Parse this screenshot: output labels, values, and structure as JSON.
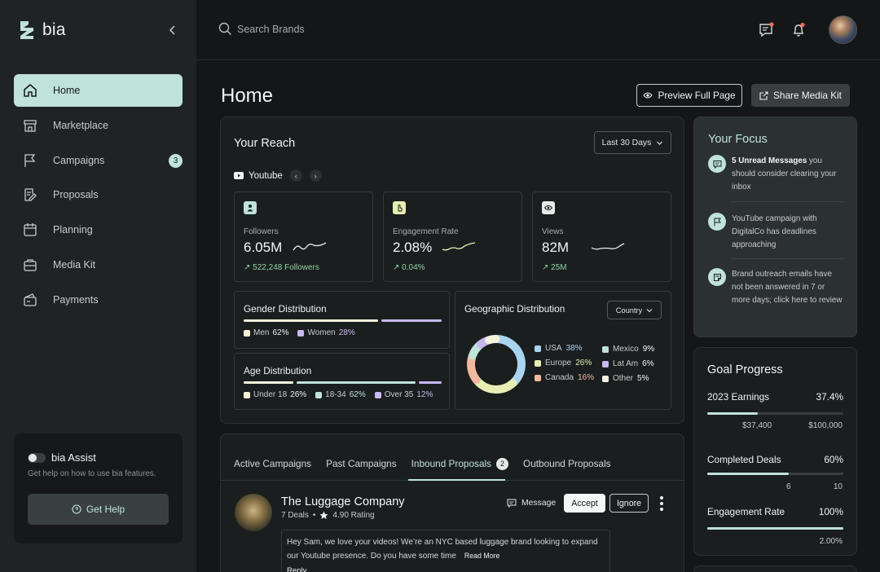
{
  "app": {
    "name": "bia"
  },
  "sidebar": {
    "items": [
      {
        "label": "Home",
        "icon": "home-icon",
        "active": true
      },
      {
        "label": "Marketplace",
        "icon": "store-icon"
      },
      {
        "label": "Campaigns",
        "icon": "flag-icon",
        "badge": "3"
      },
      {
        "label": "Proposals",
        "icon": "document-edit-icon"
      },
      {
        "label": "Planning",
        "icon": "calendar-icon"
      },
      {
        "label": "Media Kit",
        "icon": "briefcase-icon"
      },
      {
        "label": "Payments",
        "icon": "wallet-icon"
      }
    ],
    "assist": {
      "title": "bia Assist",
      "subtitle": "Get help on how to use bia features.",
      "button": "Get Help"
    }
  },
  "topbar": {
    "search_placeholder": "Search Brands"
  },
  "header": {
    "title": "Home",
    "preview_button": "Preview Full Page",
    "share_button": "Share Media Kit"
  },
  "reach": {
    "title": "Your Reach",
    "range": "Last 30 Days",
    "platform": "Youtube",
    "metrics": [
      {
        "label": "Followers",
        "value": "6.05M",
        "delta": "522,248 Followers",
        "icon_color": "#bfe3d8"
      },
      {
        "label": "Engagement Rate",
        "value": "2.08%",
        "delta": "0.04%",
        "icon_color": "#e6eeb3"
      },
      {
        "label": "Views",
        "value": "82M",
        "delta": "25M",
        "icon_color": "#e8eaea"
      }
    ],
    "gender": {
      "title": "Gender Distribution",
      "items": [
        {
          "label": "Men",
          "value": "62%",
          "pct": 0.62,
          "color": "#f5f3dc"
        },
        {
          "label": "Women",
          "value": "28%",
          "pct": 0.28,
          "color": "#c7b8f0"
        }
      ]
    },
    "age": {
      "title": "Age Distribution",
      "items": [
        {
          "label": "Under 18",
          "value": "26%",
          "pct": 0.26,
          "color": "#f5f3dc"
        },
        {
          "label": "18-34",
          "value": "62%",
          "pct": 0.62,
          "color": "#bfe3d8"
        },
        {
          "label": "Over 35",
          "value": "12%",
          "pct": 0.12,
          "color": "#c7b8f0"
        }
      ]
    },
    "geo": {
      "title": "Geographic Distribution",
      "filter": "Country",
      "items": [
        {
          "label": "USA",
          "value": "38%",
          "pct": 38,
          "color": "#a9d4ef"
        },
        {
          "label": "Europe",
          "value": "26%",
          "pct": 26,
          "color": "#e6eeb3"
        },
        {
          "label": "Canada",
          "value": "16%",
          "pct": 16,
          "color": "#f2b8a0"
        },
        {
          "label": "Mexico",
          "value": "9%",
          "pct": 9,
          "color": "#bfe3d8"
        },
        {
          "label": "Lat Am",
          "value": "6%",
          "pct": 6,
          "color": "#c7b8f0"
        },
        {
          "label": "Other",
          "value": "5%",
          "pct": 5,
          "color": "#f5f3dc"
        }
      ]
    }
  },
  "focus": {
    "title": "Your Focus",
    "items": [
      {
        "bold": "5 Unread Messages",
        "text": " you should consider clearing your inbox",
        "icon": "message-icon"
      },
      {
        "bold": "",
        "text": "YouTube campaign with DigitalCo has deadlines approaching",
        "icon": "flag-icon"
      },
      {
        "bold": "",
        "text": "Brand outreach emails have not been answered in 7 or more days; click here to review",
        "icon": "note-icon"
      }
    ]
  },
  "goals": {
    "title": "Goal Progress",
    "items": [
      {
        "label": "2023 Earnings",
        "value": "37.4%",
        "pct": 0.374,
        "current": "$37,400",
        "target": "$100,000"
      },
      {
        "label": "Completed Deals",
        "value": "60%",
        "pct": 0.6,
        "current": "6",
        "target": "10"
      },
      {
        "label": "Engagement Rate",
        "value": "100%",
        "pct": 1.0,
        "current": "",
        "target": "2.00%"
      }
    ]
  },
  "proposals": {
    "tabs": [
      {
        "label": "Active Campaigns"
      },
      {
        "label": "Past Campaigns"
      },
      {
        "label": "Inbound Proposals",
        "badge": "2",
        "active": true
      },
      {
        "label": "Outbound Proposals"
      }
    ],
    "item": {
      "brand": "The Luggage Company",
      "deals": "7 Deals",
      "rating": "4.90 Rating",
      "message_label": "Message",
      "accept": "Accept",
      "ignore": "Ignore",
      "message": "Hey Sam, we love your videos! We’re an NYC based luggage brand looking to expand our Youtube presence. Do you have some time",
      "read_more": "Read More",
      "reply": "Reply"
    }
  },
  "colors": {
    "accent": "#bfe3d8",
    "background": "#141617",
    "sidebar": "#202325",
    "card": "#1b1e1f"
  }
}
